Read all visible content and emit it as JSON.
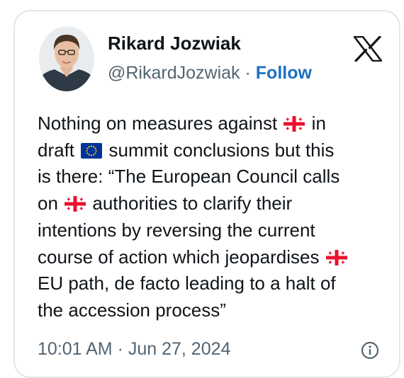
{
  "author": {
    "name": "Rikard Jozwiak",
    "handle": "@RikardJozwiak",
    "separator": "·",
    "follow_label": "Follow"
  },
  "tweet": {
    "line1_a": "Nothing on measures against",
    "line1_b": "in",
    "line2_a": "draft",
    "line2_b": "summit conclusions but this",
    "line3": "is there: “The European Council calls",
    "line4_a": "on",
    "line4_b": "authorities to clarify their",
    "line5": "intentions by reversing the current",
    "line6": "course of action which jeopardises",
    "line7": "EU path, de facto leading to a halt of",
    "line8": "the accession process”"
  },
  "timestamp": "10:01 AM · Jun 27, 2024",
  "icons": {
    "logo": "x-logo-icon",
    "georgia_flag": "georgia-flag-icon",
    "eu_flag": "eu-flag-icon",
    "info": "info-icon"
  },
  "colors": {
    "text": "#0f1419",
    "secondary": "#536471",
    "follow": "#1d6fc2",
    "border": "#e4e7ea",
    "georgia_red": "#e8112d",
    "eu_blue": "#003399",
    "eu_gold": "#ffcc00"
  }
}
